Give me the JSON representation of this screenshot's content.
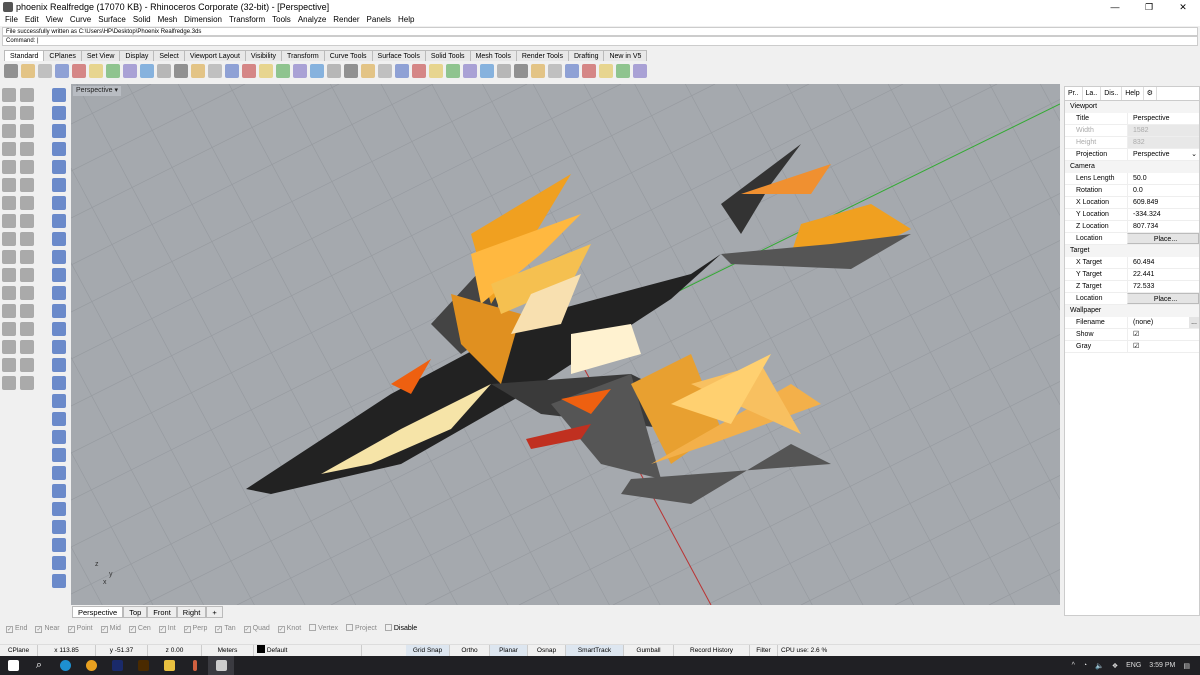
{
  "window": {
    "title": "phoenix Realfredge (17070 KB) - Rhinoceros Corporate (32-bit) - [Perspective]",
    "controls": [
      "—",
      "❐",
      "✕"
    ]
  },
  "menu": [
    "File",
    "Edit",
    "View",
    "Curve",
    "Surface",
    "Solid",
    "Mesh",
    "Dimension",
    "Transform",
    "Tools",
    "Analyze",
    "Render",
    "Panels",
    "Help"
  ],
  "command": {
    "history": "File successfully written as C:\\Users\\HP\\Desktop\\Phoenix Realfredge.3ds",
    "prompt": "Command:"
  },
  "toolbar_tabs": [
    "Standard",
    "CPlanes",
    "Set View",
    "Display",
    "Select",
    "Viewport Layout",
    "Visibility",
    "Transform",
    "Curve Tools",
    "Surface Tools",
    "Solid Tools",
    "Mesh Tools",
    "Render Tools",
    "Drafting",
    "New in V5"
  ],
  "viewport": {
    "label": "Perspective",
    "tabs": [
      "Perspective",
      "Top",
      "Front",
      "Right",
      "+"
    ],
    "axis_labels": [
      "z",
      "y",
      "x"
    ]
  },
  "panel": {
    "tabs": [
      "Pr..",
      "La..",
      "Dis..",
      "Help"
    ],
    "sections": [
      {
        "title": "Viewport",
        "rows": [
          {
            "k": "Title",
            "v": "Perspective"
          },
          {
            "k": "Width",
            "v": "1582",
            "disabled": true
          },
          {
            "k": "Height",
            "v": "832",
            "disabled": true
          },
          {
            "k": "Projection",
            "v": "Perspective",
            "dropdown": true
          }
        ]
      },
      {
        "title": "Camera",
        "rows": [
          {
            "k": "Lens Length",
            "v": "50.0"
          },
          {
            "k": "Rotation",
            "v": "0.0"
          },
          {
            "k": "X Location",
            "v": "609.849"
          },
          {
            "k": "Y Location",
            "v": "-334.324"
          },
          {
            "k": "Z Location",
            "v": "807.734"
          },
          {
            "k": "Location",
            "v": "Place...",
            "button": true
          }
        ]
      },
      {
        "title": "Target",
        "rows": [
          {
            "k": "X Target",
            "v": "60.494"
          },
          {
            "k": "Y Target",
            "v": "22.441"
          },
          {
            "k": "Z Target",
            "v": "72.533"
          },
          {
            "k": "Location",
            "v": "Place...",
            "button": true
          }
        ]
      },
      {
        "title": "Wallpaper",
        "rows": [
          {
            "k": "Filename",
            "v": "(none)",
            "more": "..."
          },
          {
            "k": "Show",
            "v": "☑"
          },
          {
            "k": "Gray",
            "v": "☑"
          }
        ]
      }
    ]
  },
  "osnap": [
    {
      "label": "End",
      "checked": true
    },
    {
      "label": "Near",
      "checked": true
    },
    {
      "label": "Point",
      "checked": true
    },
    {
      "label": "Mid",
      "checked": true
    },
    {
      "label": "Cen",
      "checked": true
    },
    {
      "label": "Int",
      "checked": true
    },
    {
      "label": "Perp",
      "checked": true
    },
    {
      "label": "Tan",
      "checked": true
    },
    {
      "label": "Quad",
      "checked": true
    },
    {
      "label": "Knot",
      "checked": true
    },
    {
      "label": "Vertex",
      "checked": false
    },
    {
      "label": "Project",
      "checked": false
    },
    {
      "label": "Disable",
      "checked": false
    }
  ],
  "status": {
    "cplane": "CPlane",
    "x": "x 113.85",
    "y": "y -51.37",
    "z": "z 0.00",
    "units": "Meters",
    "layer": "Default",
    "toggles": [
      "Grid Snap",
      "Ortho",
      "Planar",
      "Osnap",
      "SmartTrack",
      "Gumball",
      "Record History",
      "Filter"
    ],
    "cpu": "CPU use: 2.6 %"
  },
  "tray": {
    "lang": "ENG",
    "time": "3:59 PM"
  },
  "colors": {
    "viewport_bg": "#a5a9ae",
    "grid": "#9a9ea3",
    "model_orange": "#f0a020",
    "model_dark": "#2a2a2a",
    "taskbar": "#202024"
  }
}
